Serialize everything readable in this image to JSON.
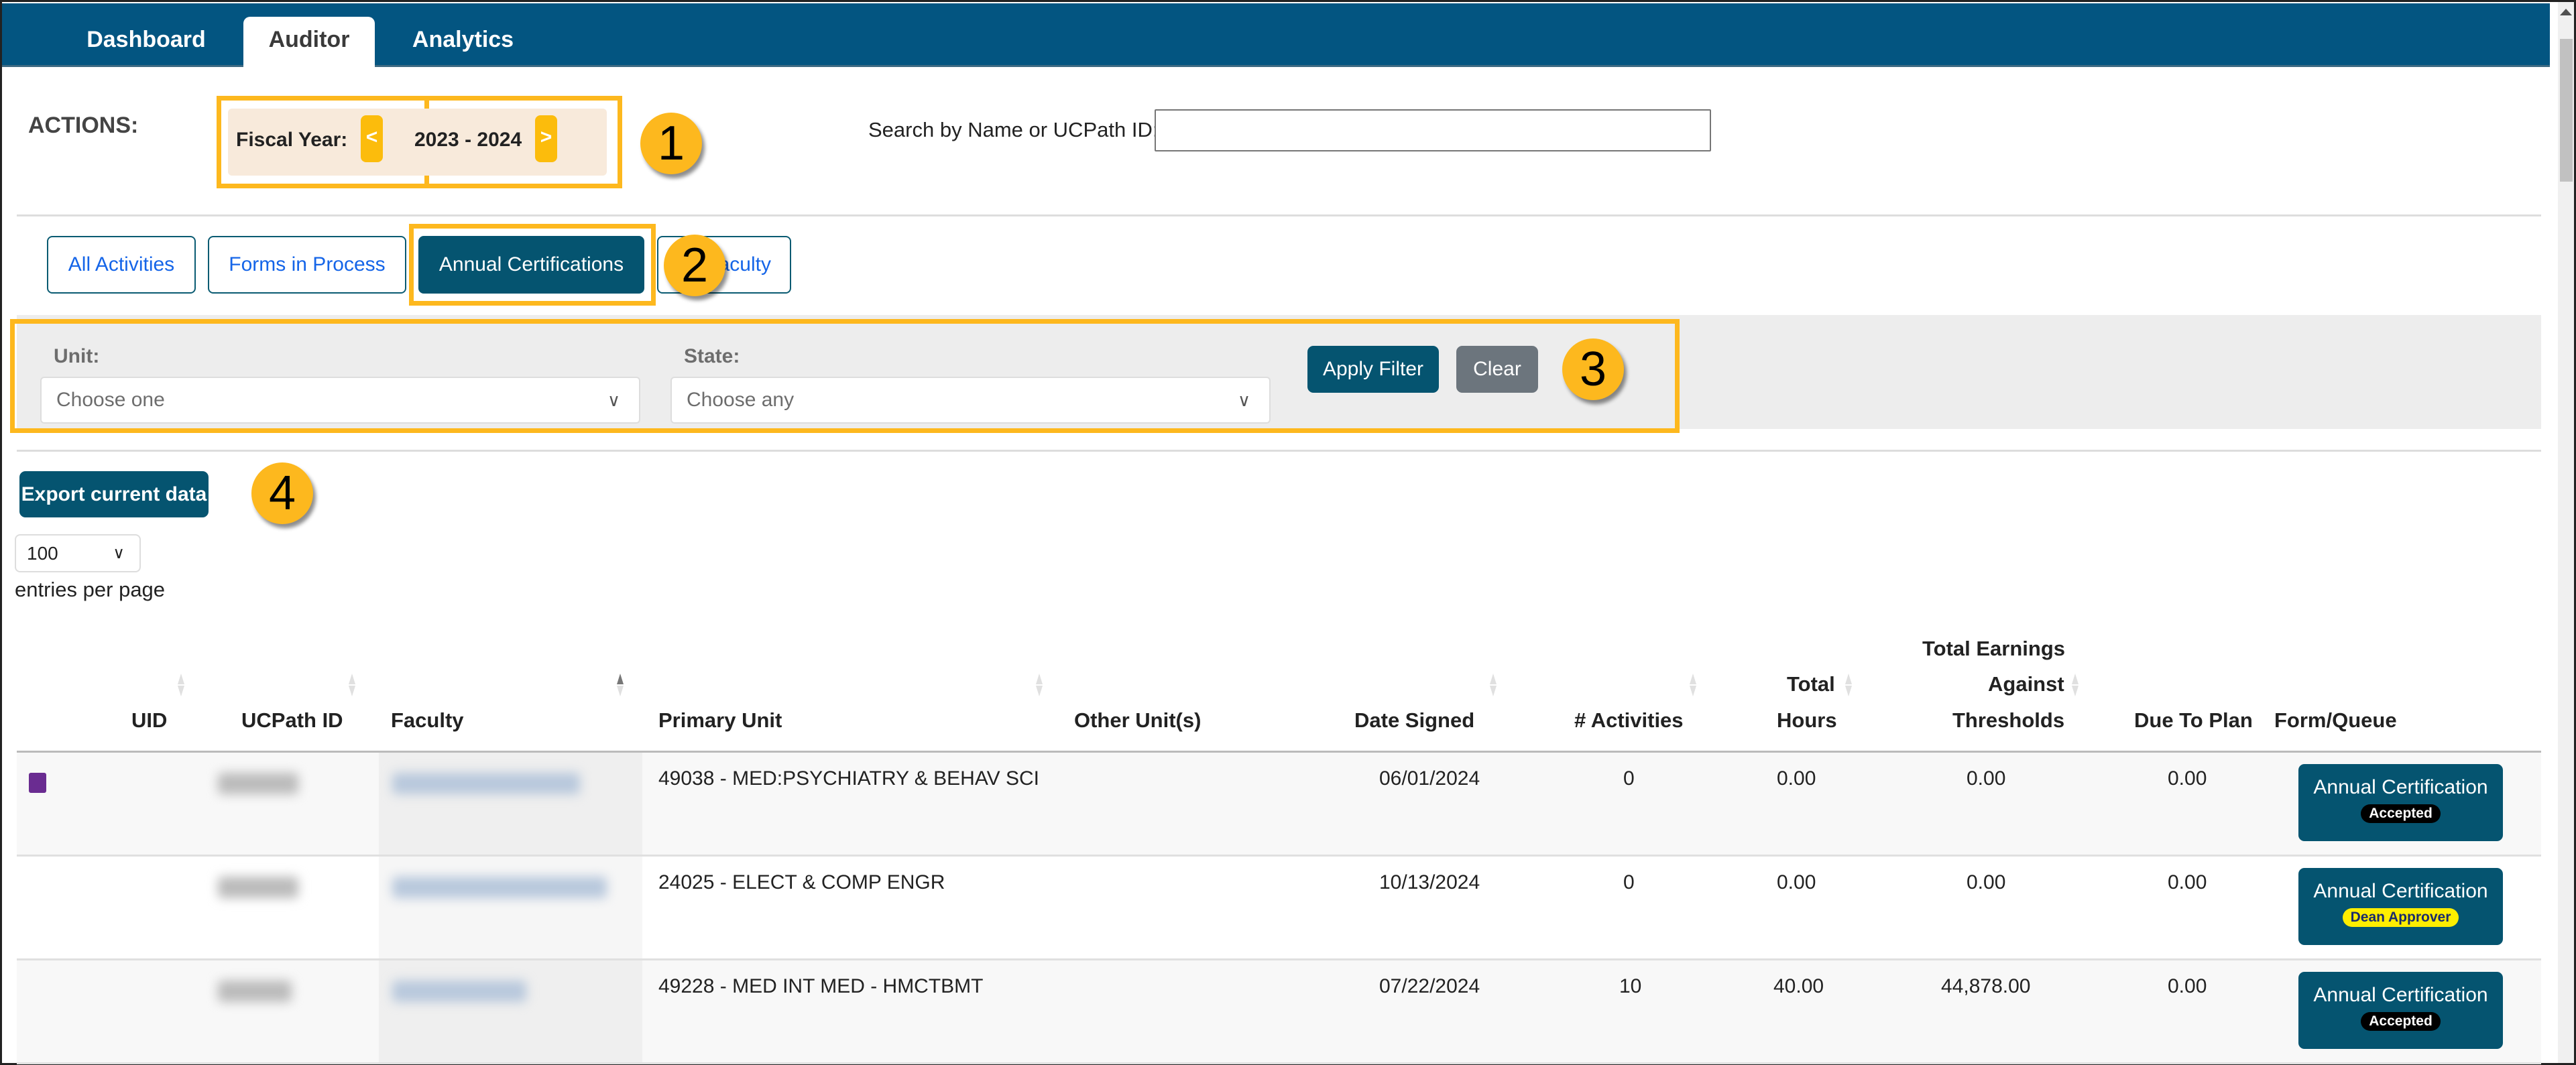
{
  "nav": {
    "tabs": [
      {
        "label": "Dashboard",
        "active": false
      },
      {
        "label": "Auditor",
        "active": true
      },
      {
        "label": "Analytics",
        "active": false
      }
    ]
  },
  "actions": {
    "label": "ACTIONS:",
    "fiscal_year": {
      "label": "Fiscal Year:",
      "prev": "<",
      "value": "2023 - 2024",
      "next": ">"
    },
    "search": {
      "label": "Search by Name or UCPath ID:",
      "value": "",
      "placeholder": ""
    }
  },
  "tabs": [
    {
      "label": "All Activities",
      "active": false
    },
    {
      "label": "Forms in Process",
      "active": false
    },
    {
      "label": "Annual Certifications",
      "active": true
    },
    {
      "label": "Faculty",
      "active": false
    }
  ],
  "filters": {
    "unit": {
      "label": "Unit:",
      "value": "Choose one"
    },
    "state": {
      "label": "State:",
      "value": "Choose any"
    },
    "apply": "Apply Filter",
    "clear": "Clear"
  },
  "export": {
    "label": "Export current data"
  },
  "pagination": {
    "page_size": "100",
    "label": "entries per page"
  },
  "annotations": [
    "1",
    "2",
    "3",
    "4"
  ],
  "table": {
    "headers": {
      "uid": "UID",
      "ucpath": "UCPath ID",
      "faculty": "Faculty",
      "primary_unit": "Primary Unit",
      "other_units": "Other Unit(s)",
      "date_signed": "Date Signed",
      "activities": "# Activities",
      "total_hours": [
        "Total",
        "Hours"
      ],
      "total_earnings": [
        "Total Earnings",
        "Against",
        "Thresholds"
      ],
      "due_to_plan": "Due To Plan",
      "form_queue": "Form/Queue"
    },
    "rows": [
      {
        "primary_unit": "49038 - MED:PSYCHIATRY & BEHAV SCI",
        "other_units": "",
        "date_signed": "06/01/2024",
        "activities": "0",
        "total_hours": "0.00",
        "total_earnings": "0.00",
        "due_to_plan": "0.00",
        "form": "Annual Certification",
        "status": "Accepted",
        "status_type": "accepted"
      },
      {
        "primary_unit": "24025 - ELECT & COMP ENGR",
        "other_units": "",
        "date_signed": "10/13/2024",
        "activities": "0",
        "total_hours": "0.00",
        "total_earnings": "0.00",
        "due_to_plan": "0.00",
        "form": "Annual Certification",
        "status": "Dean Approver",
        "status_type": "dean"
      },
      {
        "primary_unit": "49228 - MED INT MED - HMCTBMT",
        "other_units": "",
        "date_signed": "07/22/2024",
        "activities": "10",
        "total_hours": "40.00",
        "total_earnings": "44,878.00",
        "due_to_plan": "0.00",
        "form": "Annual Certification",
        "status": "Accepted",
        "status_type": "accepted"
      }
    ]
  },
  "colors": {
    "navbar": "#035581",
    "primary": "#055470",
    "annotation": "#fdb81e",
    "fiscal_year_button": "#fcbc0c",
    "link": "#1565e8",
    "accepted_badge": "#000000",
    "dean_badge": "#ffee00"
  }
}
